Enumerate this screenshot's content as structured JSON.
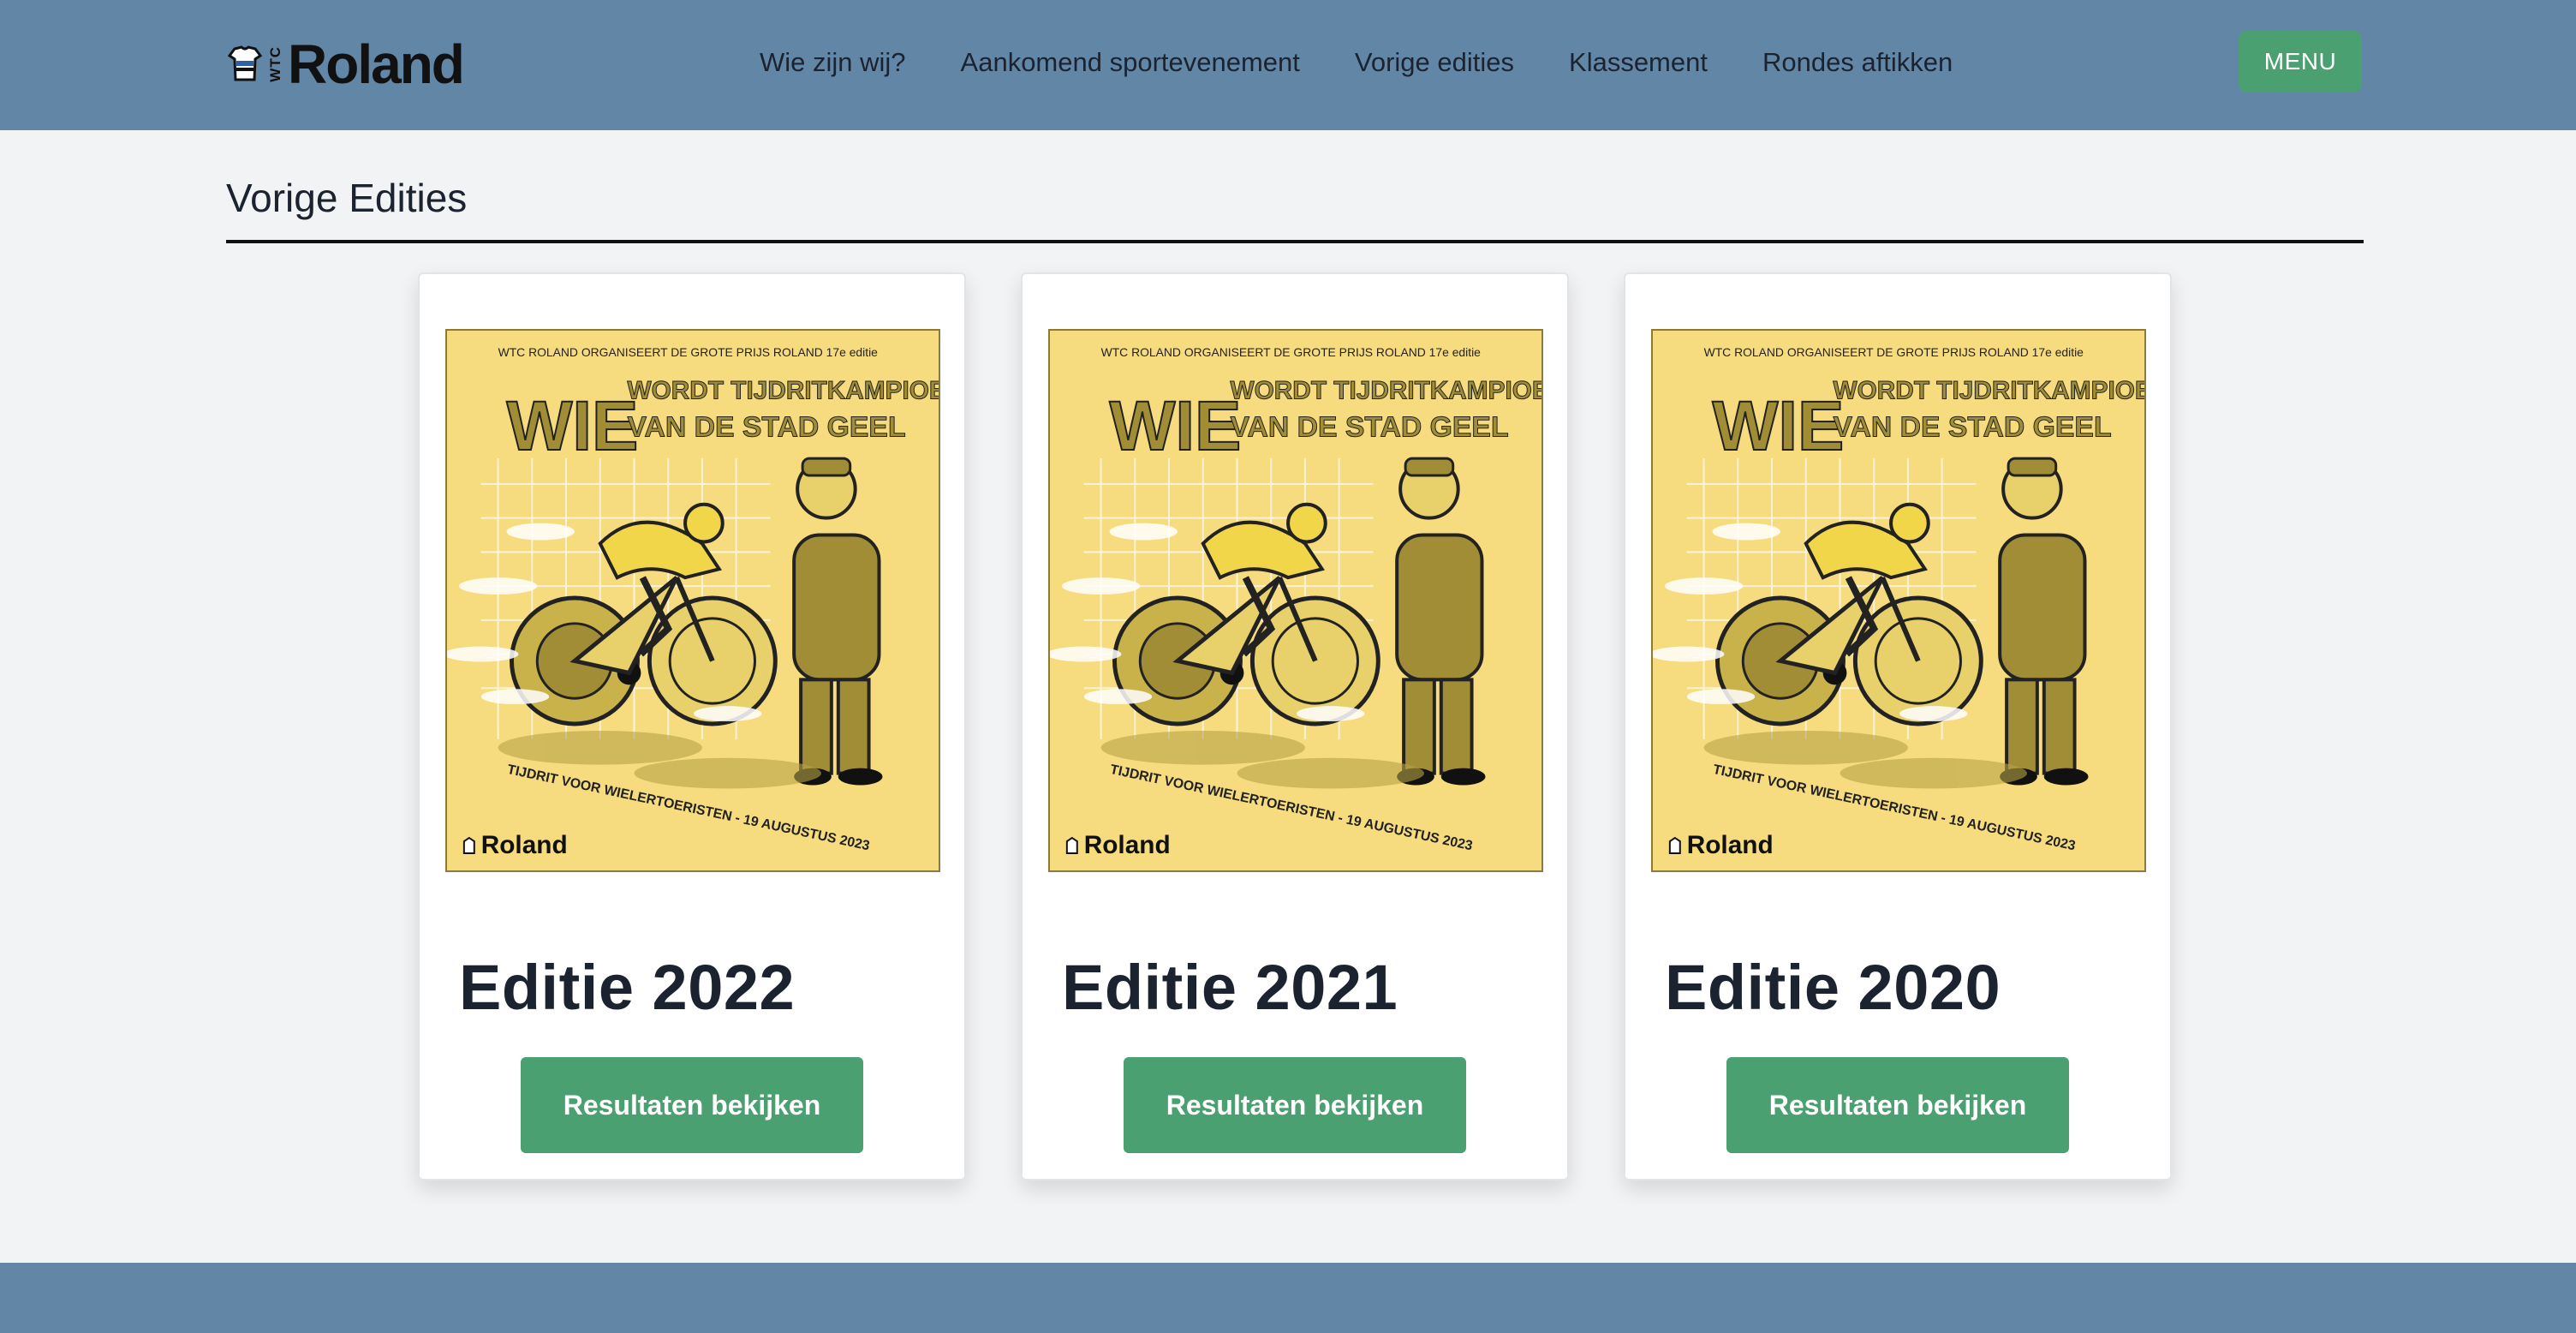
{
  "brand": {
    "small": "WTC",
    "name": "Roland"
  },
  "nav": {
    "links": [
      "Wie zijn wij?",
      "Aankomend sportevenement",
      "Vorige edities",
      "Klassement",
      "Rondes aftikken"
    ],
    "menu_label": "MENU"
  },
  "colors": {
    "navbar": "#6287a6",
    "accent_green": "#4aa071",
    "poster_yellow": "#f6dc7e",
    "page_bg": "#f2f3f5"
  },
  "page": {
    "title": "Vorige Edities"
  },
  "poster": {
    "top_line": "WTC ROLAND ORGANISEERT DE GROTE PRIJS ROLAND 17e editie",
    "big_word": "WIE",
    "headline_1": "WORDT TIJDRITKAMPIOEN",
    "headline_2": "VAN DE STAD GEEL",
    "bottom_line": "TIJDRIT VOOR WIELERTOERISTEN - 19 AUGUSTUS 2023",
    "logo_name": "Roland"
  },
  "editions": [
    {
      "title": "Editie 2022",
      "button": "Resultaten bekijken"
    },
    {
      "title": "Editie 2021",
      "button": "Resultaten bekijken"
    },
    {
      "title": "Editie 2020",
      "button": "Resultaten bekijken"
    }
  ]
}
